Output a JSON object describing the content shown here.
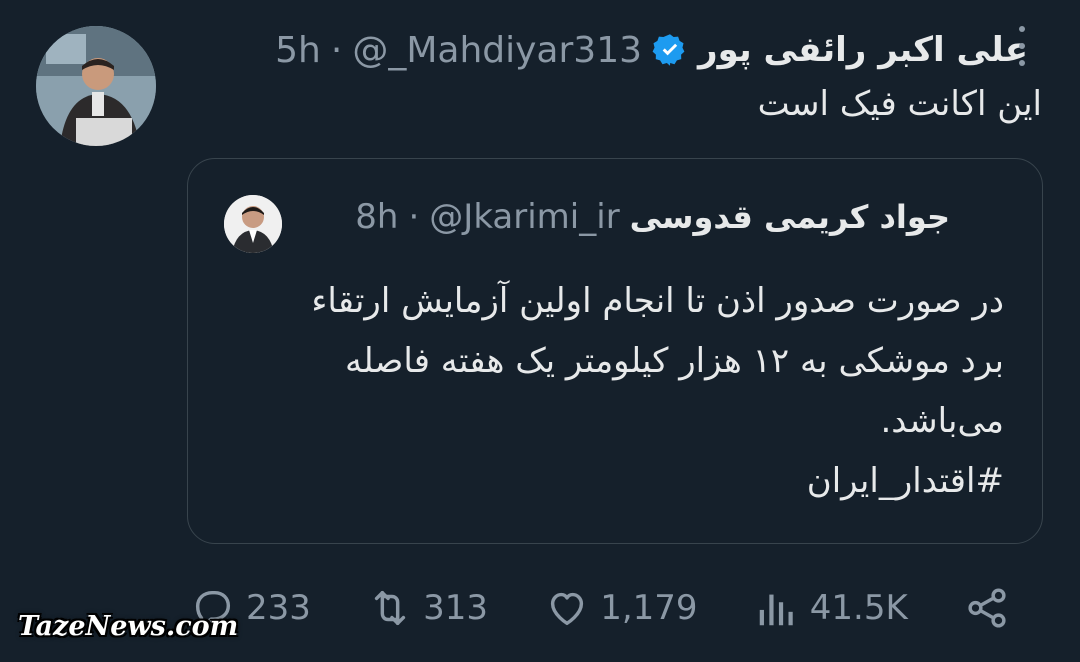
{
  "tweet": {
    "author_name": "علی اکبر رائفی پور",
    "handle": "@_Mahdiyar313",
    "separator": "·",
    "time": "5h",
    "text": "این اکانت فیک است",
    "verified": true
  },
  "quoted_tweet": {
    "author_name": "جواد کریمی قدوسی",
    "handle": "@Jkarimi_ir",
    "separator": "·",
    "time": "8h",
    "body_lines": [
      "در صورت صدور اذن تا انجام اولین آزمایش ارتقاء",
      "برد موشکی به ۱۲ هزار کیلومتر یک هفته فاصله",
      "می‌باشد."
    ],
    "hashtag": "#اقتدار_ایران"
  },
  "actions": {
    "replies": "233",
    "retweets": "313",
    "likes": "1,179",
    "views": "41.5K"
  },
  "watermark": "TazeNews.com",
  "colors": {
    "background": "#15202b",
    "text": "#e7e9ea",
    "muted": "#8b98a5",
    "border": "#38444d",
    "verified": "#1d9bf0"
  }
}
